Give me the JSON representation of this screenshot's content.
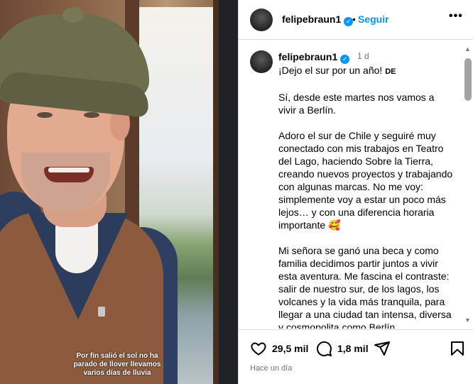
{
  "media": {
    "caption": "Por fin salió el sol no ha parado de llover llevamos varios días de lluvia"
  },
  "post": {
    "username": "felipebraun1",
    "verified_mark": "✓",
    "follow_label": "Seguir",
    "separator": "•",
    "more_label": "•••"
  },
  "comment": {
    "username": "felipebraun1",
    "time": "1 d",
    "paragraphs": [
      "¡Dejo el sur por un año! ",
      "Sí, desde este martes nos vamos a vivir a Berlín.",
      "Adoro el sur de Chile y seguiré muy conectado con mis trabajos en Teatro del Lago, haciendo Sobre la Tierra, creando nuevos proyectos y trabajando con algunas marcas. No me voy: simplemente voy a estar un poco más lejos… y con una diferencia horaria importante 🥰",
      "Mi señora se ganó una beca y como familia decidimos partir juntos a vivir esta aventura. Me fascina el contraste: salir de nuestro sur, de los lagos, los volcanes y la vida más tranquila, para llegar a una ciudad tan intensa, diversa y cosmopolita como Berlín."
    ],
    "flag": "DE"
  },
  "actions": {
    "likes": "29,5 mil",
    "comments": "1,8 mil",
    "posted": "Hace un día"
  },
  "icons": {
    "like": "heart-icon",
    "comment": "comment-bubble-icon",
    "share": "paper-plane-icon",
    "save": "bookmark-icon"
  },
  "colors": {
    "accent": "#0095f6",
    "muted": "#737373",
    "divider": "#dbdbdb"
  }
}
